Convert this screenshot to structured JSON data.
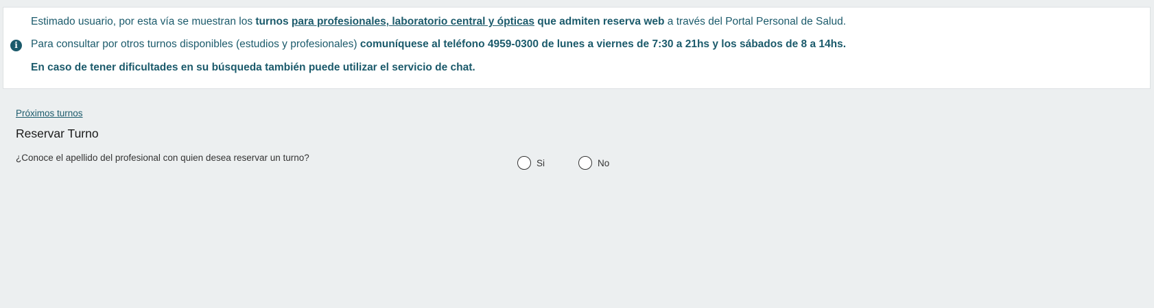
{
  "info": {
    "line1": {
      "prefix": "Estimado usuario, por esta vía se muestran los ",
      "bold1": "turnos ",
      "link": "para profesionales, laboratorio central y ópticas",
      "bold2": " que admiten reserva web",
      "suffix": " a través del Portal Personal de Salud."
    },
    "line2": {
      "prefix": "Para consultar por otros turnos disponibles (estudios y profesionales) ",
      "bold": "comuníquese al teléfono 4959-0300 de lunes a viernes de 7:30 a 21hs y los sábados de 8 a 14hs."
    },
    "line3": "En caso de tener dificultades en su búsqueda también puede utilizar el servicio de chat.",
    "icon": "info-circle-icon"
  },
  "nav": {
    "proximos_turnos": "Próximos turnos"
  },
  "page": {
    "title": "Reservar Turno",
    "question": "¿Conoce el apellido del profesional con quien desea reservar un turno?",
    "options": [
      {
        "label": "Si"
      },
      {
        "label": "No"
      }
    ]
  },
  "colors": {
    "accent": "#1b5a6b",
    "background": "#eceff0"
  }
}
